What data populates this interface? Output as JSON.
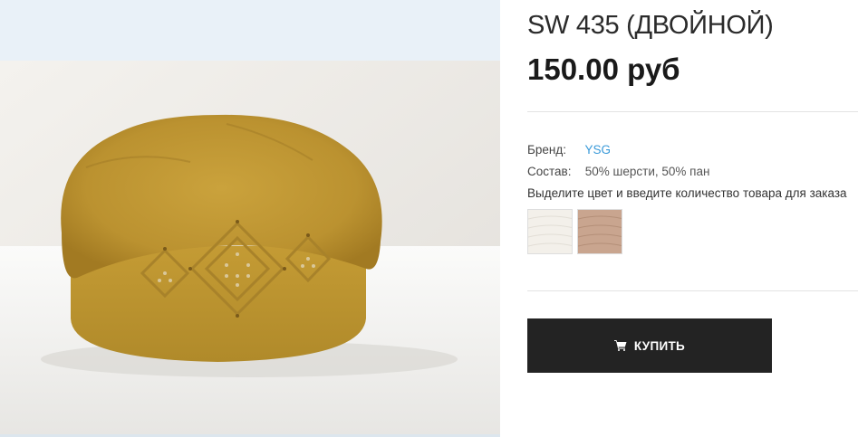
{
  "product": {
    "title": "SW 435 (ДВОЙНОЙ)",
    "price": "150.00 руб"
  },
  "attributes": {
    "brand_label": "Бренд:",
    "brand_value": "YSG",
    "composition_label": "Состав:",
    "composition_value": "50% шерсти, 50% пан"
  },
  "select_hint": "Выделите цвет и введите количество товара для заказа",
  "swatches": [
    {
      "name": "white",
      "color": "#f3f0ea"
    },
    {
      "name": "beige",
      "color": "#c9a58f"
    }
  ],
  "buy_button": {
    "label": "КУПИТЬ",
    "icon": "cart-icon"
  },
  "colors": {
    "hat": "#c79b33",
    "button_bg": "#232323",
    "link": "#3a9ad9"
  }
}
